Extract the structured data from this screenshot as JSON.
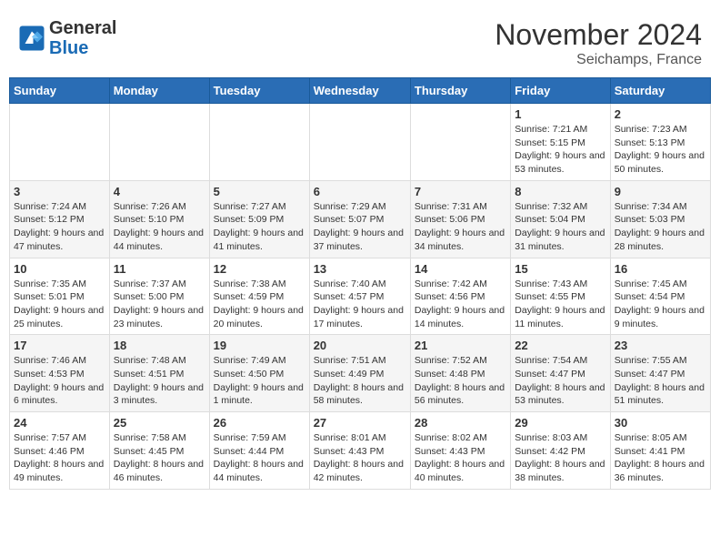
{
  "header": {
    "logo_line1": "General",
    "logo_line2": "Blue",
    "month_title": "November 2024",
    "location": "Seichamps, France"
  },
  "weekdays": [
    "Sunday",
    "Monday",
    "Tuesday",
    "Wednesday",
    "Thursday",
    "Friday",
    "Saturday"
  ],
  "weeks": [
    [
      {
        "day": "",
        "info": ""
      },
      {
        "day": "",
        "info": ""
      },
      {
        "day": "",
        "info": ""
      },
      {
        "day": "",
        "info": ""
      },
      {
        "day": "",
        "info": ""
      },
      {
        "day": "1",
        "info": "Sunrise: 7:21 AM\nSunset: 5:15 PM\nDaylight: 9 hours and 53 minutes."
      },
      {
        "day": "2",
        "info": "Sunrise: 7:23 AM\nSunset: 5:13 PM\nDaylight: 9 hours and 50 minutes."
      }
    ],
    [
      {
        "day": "3",
        "info": "Sunrise: 7:24 AM\nSunset: 5:12 PM\nDaylight: 9 hours and 47 minutes."
      },
      {
        "day": "4",
        "info": "Sunrise: 7:26 AM\nSunset: 5:10 PM\nDaylight: 9 hours and 44 minutes."
      },
      {
        "day": "5",
        "info": "Sunrise: 7:27 AM\nSunset: 5:09 PM\nDaylight: 9 hours and 41 minutes."
      },
      {
        "day": "6",
        "info": "Sunrise: 7:29 AM\nSunset: 5:07 PM\nDaylight: 9 hours and 37 minutes."
      },
      {
        "day": "7",
        "info": "Sunrise: 7:31 AM\nSunset: 5:06 PM\nDaylight: 9 hours and 34 minutes."
      },
      {
        "day": "8",
        "info": "Sunrise: 7:32 AM\nSunset: 5:04 PM\nDaylight: 9 hours and 31 minutes."
      },
      {
        "day": "9",
        "info": "Sunrise: 7:34 AM\nSunset: 5:03 PM\nDaylight: 9 hours and 28 minutes."
      }
    ],
    [
      {
        "day": "10",
        "info": "Sunrise: 7:35 AM\nSunset: 5:01 PM\nDaylight: 9 hours and 25 minutes."
      },
      {
        "day": "11",
        "info": "Sunrise: 7:37 AM\nSunset: 5:00 PM\nDaylight: 9 hours and 23 minutes."
      },
      {
        "day": "12",
        "info": "Sunrise: 7:38 AM\nSunset: 4:59 PM\nDaylight: 9 hours and 20 minutes."
      },
      {
        "day": "13",
        "info": "Sunrise: 7:40 AM\nSunset: 4:57 PM\nDaylight: 9 hours and 17 minutes."
      },
      {
        "day": "14",
        "info": "Sunrise: 7:42 AM\nSunset: 4:56 PM\nDaylight: 9 hours and 14 minutes."
      },
      {
        "day": "15",
        "info": "Sunrise: 7:43 AM\nSunset: 4:55 PM\nDaylight: 9 hours and 11 minutes."
      },
      {
        "day": "16",
        "info": "Sunrise: 7:45 AM\nSunset: 4:54 PM\nDaylight: 9 hours and 9 minutes."
      }
    ],
    [
      {
        "day": "17",
        "info": "Sunrise: 7:46 AM\nSunset: 4:53 PM\nDaylight: 9 hours and 6 minutes."
      },
      {
        "day": "18",
        "info": "Sunrise: 7:48 AM\nSunset: 4:51 PM\nDaylight: 9 hours and 3 minutes."
      },
      {
        "day": "19",
        "info": "Sunrise: 7:49 AM\nSunset: 4:50 PM\nDaylight: 9 hours and 1 minute."
      },
      {
        "day": "20",
        "info": "Sunrise: 7:51 AM\nSunset: 4:49 PM\nDaylight: 8 hours and 58 minutes."
      },
      {
        "day": "21",
        "info": "Sunrise: 7:52 AM\nSunset: 4:48 PM\nDaylight: 8 hours and 56 minutes."
      },
      {
        "day": "22",
        "info": "Sunrise: 7:54 AM\nSunset: 4:47 PM\nDaylight: 8 hours and 53 minutes."
      },
      {
        "day": "23",
        "info": "Sunrise: 7:55 AM\nSunset: 4:47 PM\nDaylight: 8 hours and 51 minutes."
      }
    ],
    [
      {
        "day": "24",
        "info": "Sunrise: 7:57 AM\nSunset: 4:46 PM\nDaylight: 8 hours and 49 minutes."
      },
      {
        "day": "25",
        "info": "Sunrise: 7:58 AM\nSunset: 4:45 PM\nDaylight: 8 hours and 46 minutes."
      },
      {
        "day": "26",
        "info": "Sunrise: 7:59 AM\nSunset: 4:44 PM\nDaylight: 8 hours and 44 minutes."
      },
      {
        "day": "27",
        "info": "Sunrise: 8:01 AM\nSunset: 4:43 PM\nDaylight: 8 hours and 42 minutes."
      },
      {
        "day": "28",
        "info": "Sunrise: 8:02 AM\nSunset: 4:43 PM\nDaylight: 8 hours and 40 minutes."
      },
      {
        "day": "29",
        "info": "Sunrise: 8:03 AM\nSunset: 4:42 PM\nDaylight: 8 hours and 38 minutes."
      },
      {
        "day": "30",
        "info": "Sunrise: 8:05 AM\nSunset: 4:41 PM\nDaylight: 8 hours and 36 minutes."
      }
    ]
  ]
}
